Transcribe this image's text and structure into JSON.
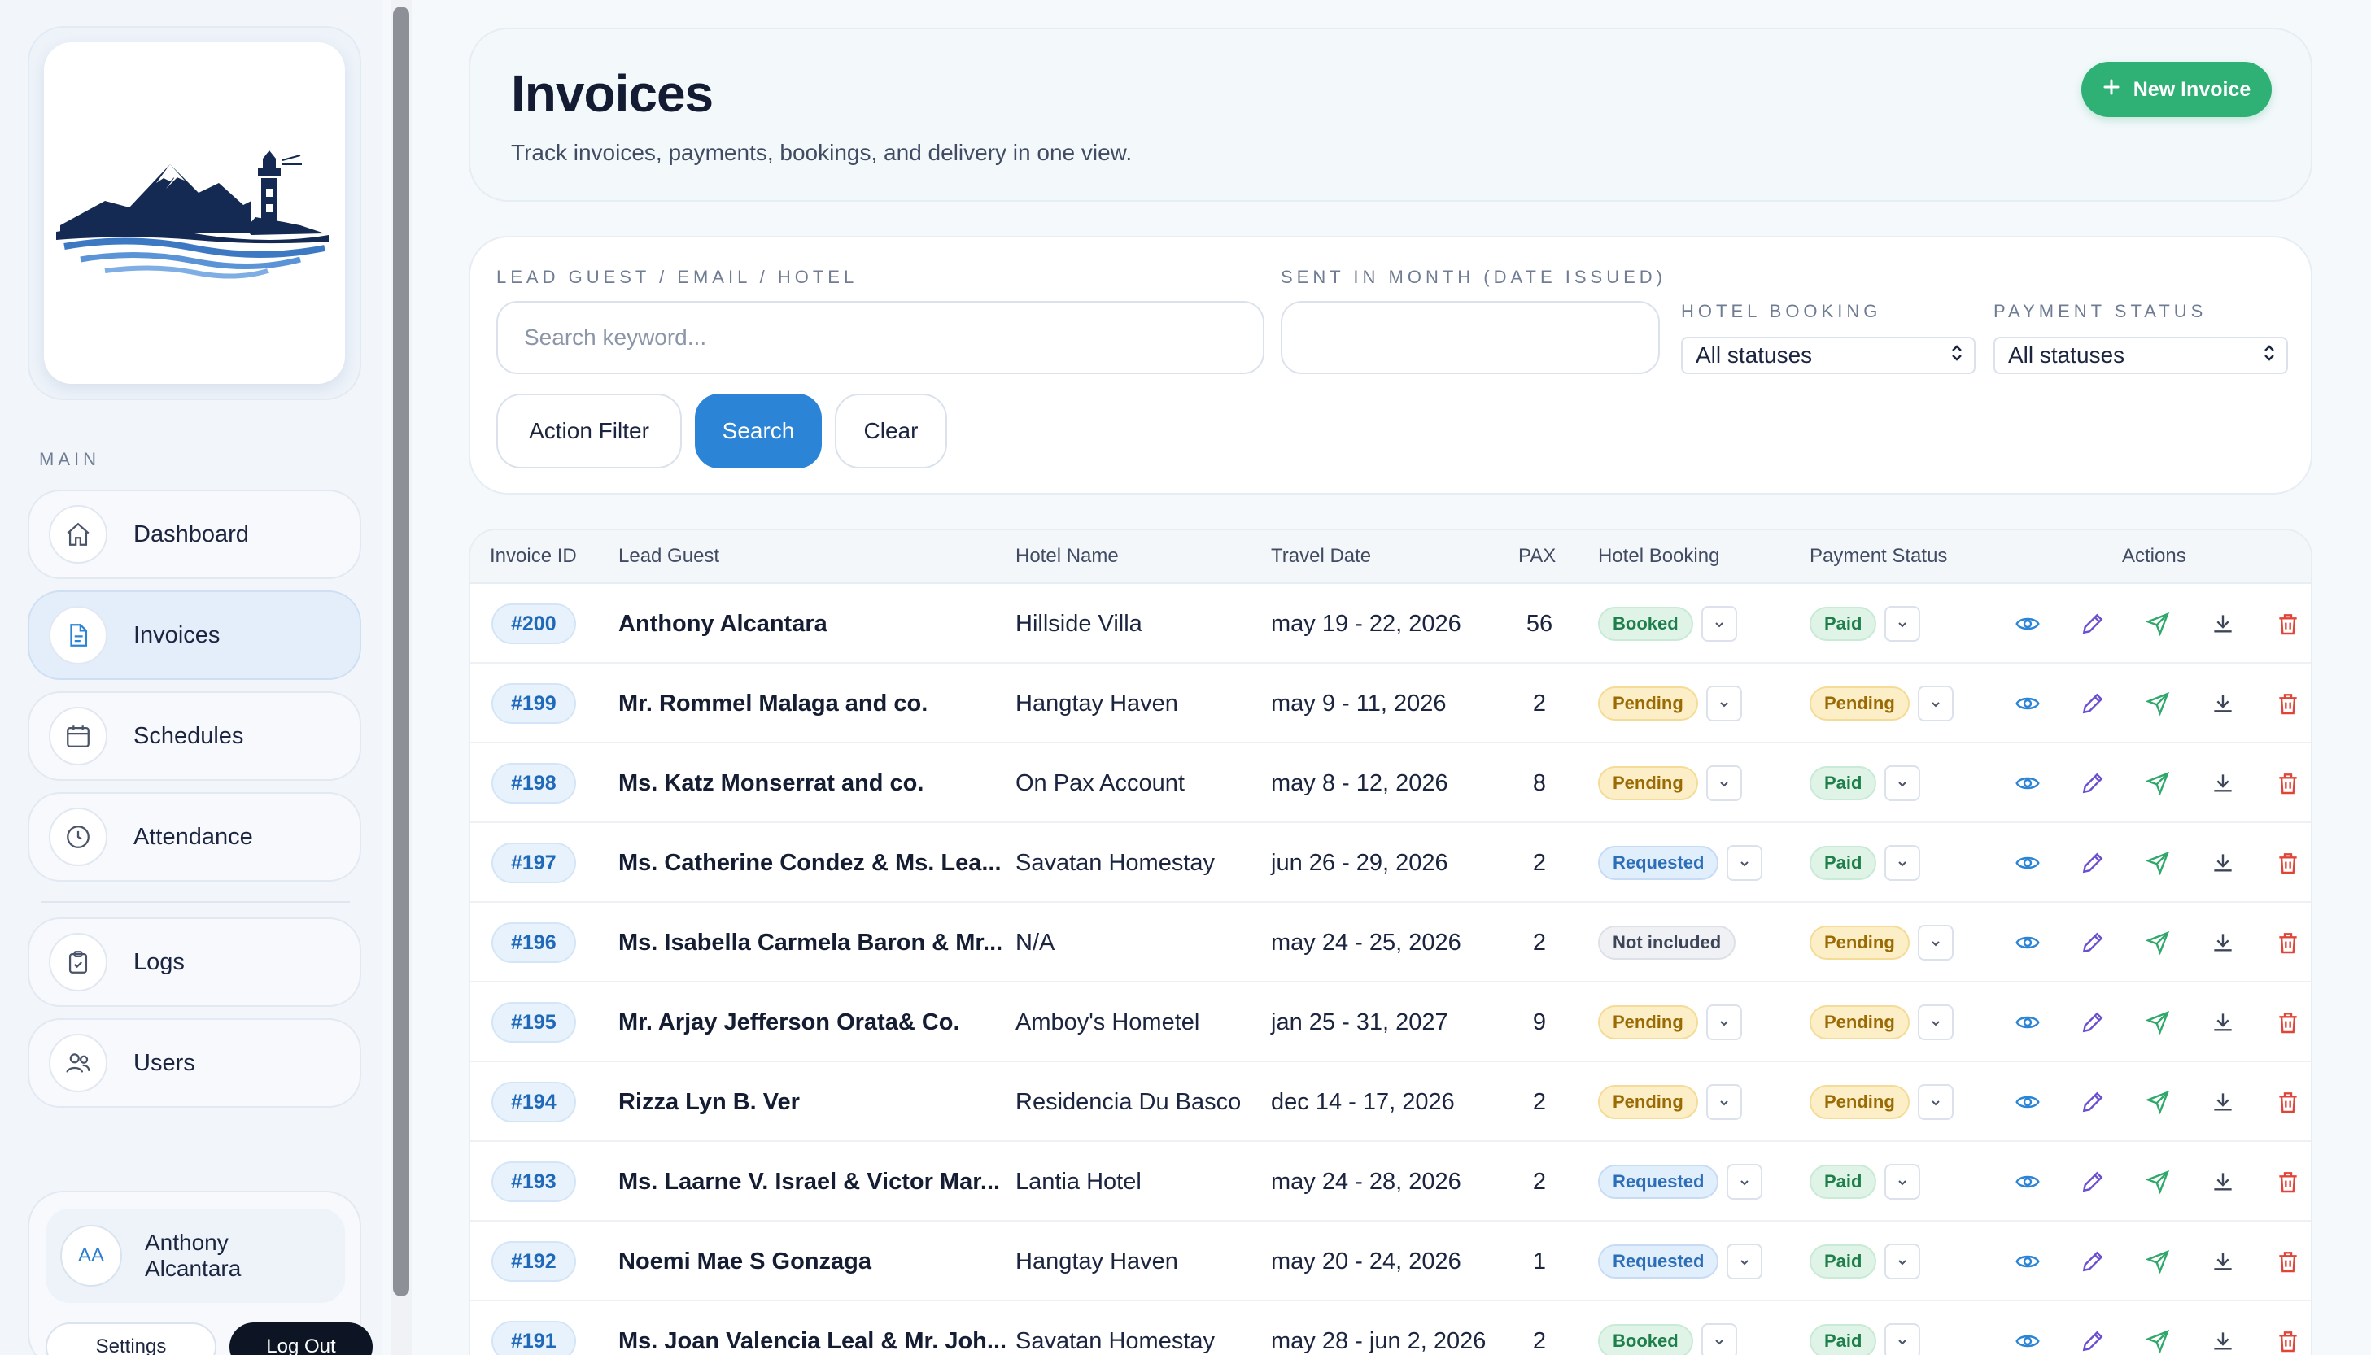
{
  "sidebar": {
    "section_label": "MAIN",
    "items": [
      {
        "label": "Dashboard",
        "icon": "home-icon"
      },
      {
        "label": "Invoices",
        "icon": "document-icon",
        "active": true
      },
      {
        "label": "Schedules",
        "icon": "calendar-icon"
      },
      {
        "label": "Attendance",
        "icon": "clock-icon"
      },
      {
        "label": "Logs",
        "icon": "clipboard-icon"
      },
      {
        "label": "Users",
        "icon": "users-icon"
      }
    ],
    "user": {
      "initials": "AA",
      "name": "Anthony Alcantara"
    },
    "settings_label": "Settings",
    "logout_label": "Log Out"
  },
  "header": {
    "title": "Invoices",
    "subtitle": "Track invoices, payments, bookings, and delivery in one view.",
    "new_button_label": "New Invoice"
  },
  "filters": {
    "search_label": "LEAD GUEST / EMAIL / HOTEL",
    "search_placeholder": "Search keyword...",
    "month_label": "SENT IN MONTH (DATE ISSUED)",
    "month_value": "",
    "hotel_booking_label": "HOTEL BOOKING",
    "hotel_booking_value": "All statuses",
    "payment_status_label": "PAYMENT STATUS",
    "payment_status_value": "All statuses",
    "action_filter_label": "Action Filter",
    "search_button_label": "Search",
    "clear_button_label": "Clear"
  },
  "table": {
    "columns": [
      "Invoice ID",
      "Lead Guest",
      "Hotel Name",
      "Travel Date",
      "PAX",
      "Hotel Booking",
      "Payment Status",
      "Actions"
    ],
    "rows": [
      {
        "id": "#200",
        "guest": "Anthony Alcantara",
        "hotel": "Hillside Villa",
        "date": "may 19 - 22, 2026",
        "pax": "56",
        "booking": "Booked",
        "payment": "Paid"
      },
      {
        "id": "#199",
        "guest": "Mr. Rommel Malaga and co.",
        "hotel": "Hangtay Haven",
        "date": "may 9 - 11, 2026",
        "pax": "2",
        "booking": "Pending",
        "payment": "Pending"
      },
      {
        "id": "#198",
        "guest": "Ms. Katz Monserrat and co.",
        "hotel": "On Pax Account",
        "date": "may 8 - 12, 2026",
        "pax": "8",
        "booking": "Pending",
        "payment": "Paid"
      },
      {
        "id": "#197",
        "guest": "Ms. Catherine Condez & Ms. Lea...",
        "hotel": "Savatan Homestay",
        "date": "jun 26 - 29, 2026",
        "pax": "2",
        "booking": "Requested",
        "payment": "Paid"
      },
      {
        "id": "#196",
        "guest": "Ms. Isabella Carmela Baron & Mr...",
        "hotel": "N/A",
        "date": "may 24 - 25, 2026",
        "pax": "2",
        "booking": "Not included",
        "payment": "Pending"
      },
      {
        "id": "#195",
        "guest": "Mr. Arjay Jefferson Orata& Co.",
        "hotel": "Amboy's Hometel",
        "date": "jan 25 - 31, 2027",
        "pax": "9",
        "booking": "Pending",
        "payment": "Pending"
      },
      {
        "id": "#194",
        "guest": "Rizza Lyn B. Ver",
        "hotel": "Residencia Du Basco",
        "date": "dec 14 - 17, 2026",
        "pax": "2",
        "booking": "Pending",
        "payment": "Pending"
      },
      {
        "id": "#193",
        "guest": "Ms. Laarne V. Israel & Victor Mar...",
        "hotel": "Lantia Hotel",
        "date": "may 24 - 28, 2026",
        "pax": "2",
        "booking": "Requested",
        "payment": "Paid"
      },
      {
        "id": "#192",
        "guest": "Noemi Mae S Gonzaga",
        "hotel": "Hangtay Haven",
        "date": "may 20 - 24, 2026",
        "pax": "1",
        "booking": "Requested",
        "payment": "Paid"
      },
      {
        "id": "#191",
        "guest": "Ms. Joan Valencia Leal & Mr. Joh...",
        "hotel": "Savatan Homestay",
        "date": "may 28 - jun 2, 2026",
        "pax": "2",
        "booking": "Booked",
        "payment": "Paid"
      }
    ]
  },
  "colors": {
    "accent_blue": "#2c84d6",
    "accent_green": "#2fb074",
    "danger_red": "#e0453a",
    "view_icon": "#2c84d6",
    "edit_icon": "#6b4fd0",
    "send_icon": "#2fa86a",
    "download_icon": "#3d4658"
  }
}
